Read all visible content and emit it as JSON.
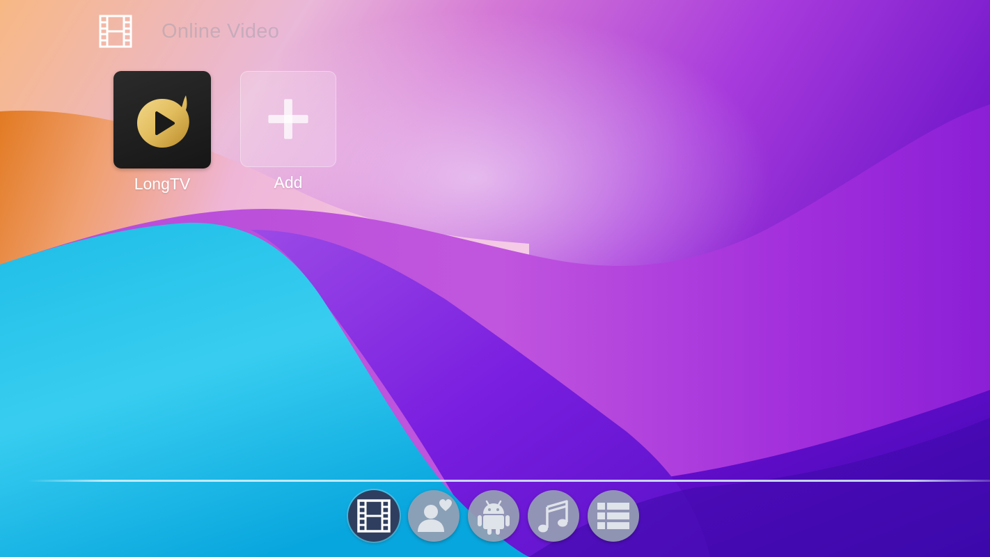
{
  "header": {
    "title": "Online Video",
    "icon": "film-strip-icon"
  },
  "apps": [
    {
      "label": "LongTV",
      "icon": "longtv-play-icon"
    },
    {
      "label": "Add",
      "icon": "plus-icon"
    }
  ],
  "dock": {
    "items": [
      {
        "name": "video",
        "icon": "film-strip-icon",
        "active": true
      },
      {
        "name": "favorites",
        "icon": "person-heart-icon",
        "active": false
      },
      {
        "name": "apps",
        "icon": "android-icon",
        "active": false
      },
      {
        "name": "music",
        "icon": "music-note-icon",
        "active": false
      },
      {
        "name": "settings",
        "icon": "list-icon",
        "active": false
      }
    ]
  },
  "colors": {
    "dock_active": "#2f3e5e",
    "dock_inactive": "#96a0b2",
    "longtv_gold": "#e2bd5e"
  }
}
